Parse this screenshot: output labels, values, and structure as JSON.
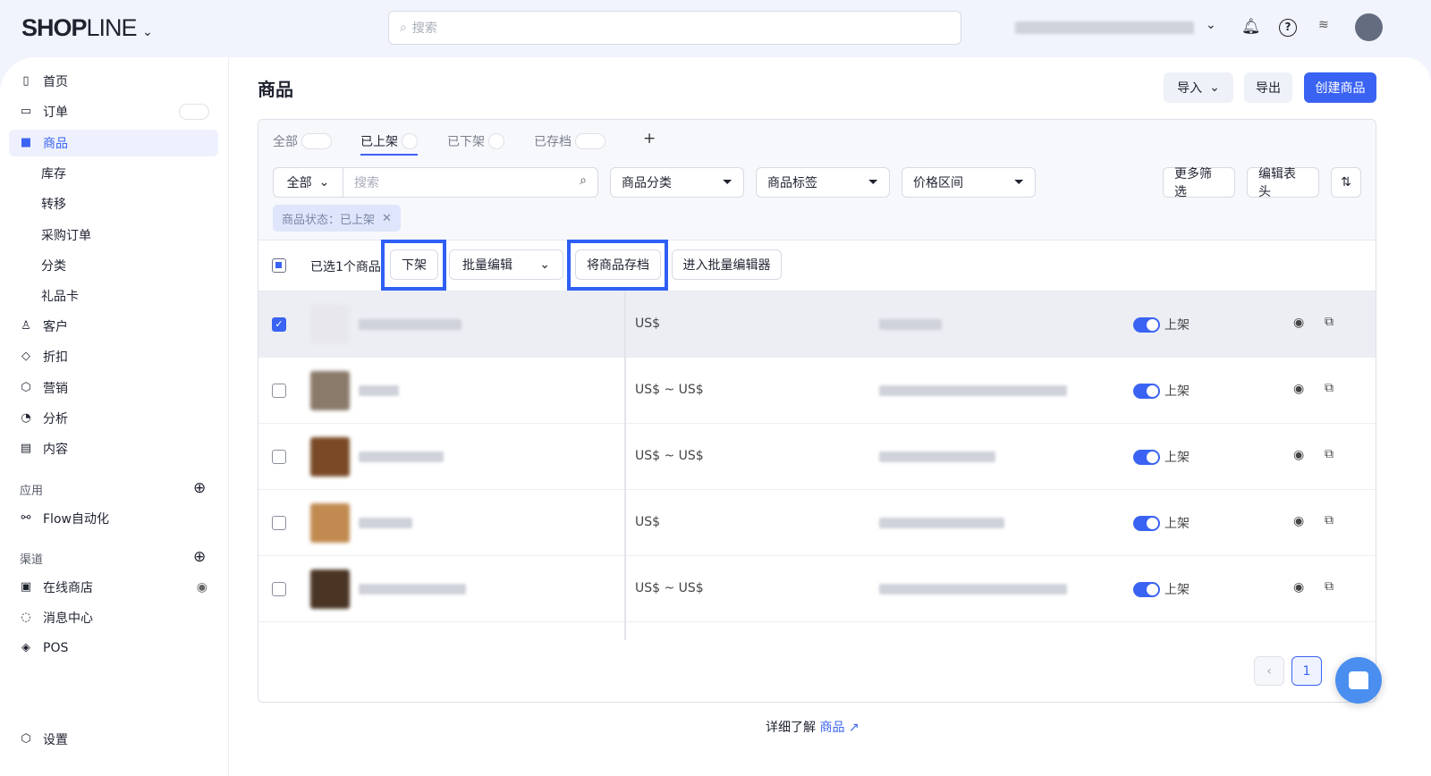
{
  "header": {
    "logo": "SHOPLINE",
    "search_placeholder": "搜索",
    "icons": [
      "chevron-down-icon",
      "bell-icon",
      "help-icon",
      "wifi-icon",
      "avatar-icon"
    ]
  },
  "sidebar": {
    "items": [
      {
        "label": "首页",
        "icon": "home-icon"
      },
      {
        "label": "订单",
        "icon": "order-icon"
      },
      {
        "label": "商品",
        "icon": "bag-icon",
        "active": true
      },
      {
        "label": "库存"
      },
      {
        "label": "转移"
      },
      {
        "label": "采购订单"
      },
      {
        "label": "分类"
      },
      {
        "label": "礼品卡"
      },
      {
        "label": "客户",
        "icon": "user-icon"
      },
      {
        "label": "折扣",
        "icon": "tag-icon"
      },
      {
        "label": "营销",
        "icon": "cube-icon"
      },
      {
        "label": "分析",
        "icon": "pie-icon"
      },
      {
        "label": "内容",
        "icon": "doc-icon"
      }
    ],
    "apps_title": "应用",
    "apps": [
      {
        "label": "Flow自动化"
      }
    ],
    "channels_title": "渠道",
    "channels": [
      {
        "label": "在线商店"
      },
      {
        "label": "消息中心"
      },
      {
        "label": "POS"
      }
    ],
    "settings": "设置"
  },
  "page": {
    "title": "商品",
    "import": "导入",
    "export": "导出",
    "create": "创建商品"
  },
  "tabs": [
    {
      "label": "全部"
    },
    {
      "label": "已上架",
      "active": true
    },
    {
      "label": "已下架"
    },
    {
      "label": "已存档"
    },
    {
      "label": "+"
    }
  ],
  "filters": {
    "scope": "全部",
    "search_placeholder": "搜索",
    "category": "商品分类",
    "tags": "商品标签",
    "price": "价格区间",
    "more": "更多筛选",
    "edit_columns": "编辑表头",
    "sort": "⇅",
    "chip": "商品状态：已上架"
  },
  "bulk": {
    "selected": "已选1个商品",
    "unlist": "下架",
    "bulk_edit": "批量编辑",
    "archive": "将商品存档",
    "bulk_editor": "进入批量编辑器"
  },
  "rows": [
    {
      "price": "US$",
      "status": "上架",
      "checked": true,
      "thumb": "#e8e8ec"
    },
    {
      "price": "US$ ~ US$",
      "status": "上架",
      "checked": false,
      "thumb": "#8a7a6a"
    },
    {
      "price": "US$ ~ US$",
      "status": "上架",
      "checked": false,
      "thumb": "#7a4a26"
    },
    {
      "price": "US$",
      "status": "上架",
      "checked": false,
      "thumb": "#c08a50"
    },
    {
      "price": "US$ ~ US$",
      "status": "上架",
      "checked": false,
      "thumb": "#4a3424"
    }
  ],
  "pagination": {
    "current": "1"
  },
  "footer": {
    "text": "详细了解",
    "link": "商品"
  },
  "colors": {
    "accent": "#3a63f3",
    "highlight": "#2f5ff5"
  }
}
